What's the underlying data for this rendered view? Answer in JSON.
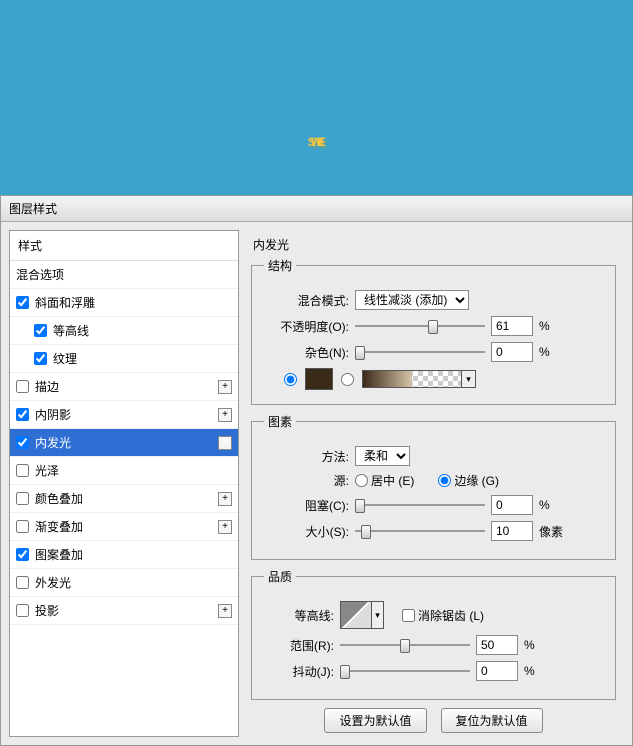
{
  "preview_text": "SWEET",
  "dialog_title": "图层样式",
  "left": {
    "header": "样式",
    "blend": "混合选项",
    "items": [
      {
        "label": "斜面和浮雕",
        "chk": true,
        "plus": false
      },
      {
        "label": "等高线",
        "chk": true,
        "sub": true
      },
      {
        "label": "纹理",
        "chk": true,
        "sub": true
      },
      {
        "label": "描边",
        "chk": false,
        "plus": true
      },
      {
        "label": "内阴影",
        "chk": true,
        "plus": true
      },
      {
        "label": "内发光",
        "chk": true,
        "plus": true,
        "sel": true
      },
      {
        "label": "光泽",
        "chk": false
      },
      {
        "label": "颜色叠加",
        "chk": false,
        "plus": true
      },
      {
        "label": "渐变叠加",
        "chk": false,
        "plus": true
      },
      {
        "label": "图案叠加",
        "chk": true
      },
      {
        "label": "外发光",
        "chk": false
      },
      {
        "label": "投影",
        "chk": false,
        "plus": true
      }
    ]
  },
  "right": {
    "title": "内发光",
    "struct": {
      "legend": "结构",
      "blend_label": "混合模式:",
      "blend_value": "线性减淡 (添加)",
      "opacity_label": "不透明度(O):",
      "opacity_value": "61",
      "opacity_pct": 61,
      "pct": "%",
      "noise_label": "杂色(N):",
      "noise_value": "0",
      "noise_pct": 0,
      "swatch_color": "#3a2a18"
    },
    "elem": {
      "legend": "图素",
      "method_label": "方法:",
      "method_value": "柔和",
      "source_label": "源:",
      "center": "居中 (E)",
      "edge": "边缘 (G)",
      "choke_label": "阻塞(C):",
      "choke_value": "0",
      "choke_pct": 0,
      "size_label": "大小(S):",
      "size_value": "10",
      "size_pct": 5,
      "size_unit": "像素"
    },
    "qual": {
      "legend": "品质",
      "contour_label": "等高线:",
      "aa_label": "消除锯齿 (L)",
      "range_label": "范围(R):",
      "range_value": "50",
      "range_pct": 50,
      "jitter_label": "抖动(J):",
      "jitter_value": "0",
      "jitter_pct": 0
    },
    "btn_default": "设置为默认值",
    "btn_reset": "复位为默认值"
  }
}
